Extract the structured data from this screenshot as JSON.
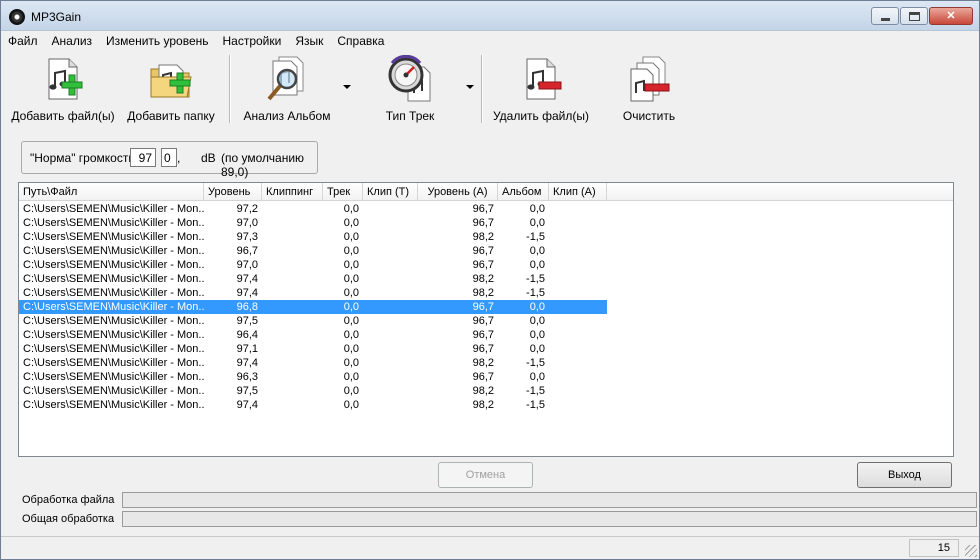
{
  "window": {
    "title": "MP3Gain"
  },
  "menu": [
    "Файл",
    "Анализ",
    "Изменить уровень",
    "Настройки",
    "Язык",
    "Справка"
  ],
  "toolbar": {
    "add_file": "Добавить файл(ы)",
    "add_folder": "Добавить папку",
    "analysis": "Анализ Альбом",
    "track_type": "Тип Трек",
    "remove_file": "Удалить файл(ы)",
    "clear": "Очистить"
  },
  "norm": {
    "label": "\"Норма\" громкости:",
    "int_value": "97",
    "comma": ",",
    "frac_value": "0",
    "unit": "dB",
    "default_text": "(по умолчанию 89,0)"
  },
  "table": {
    "columns": [
      "Путь\\Файл",
      "Уровень",
      "Клиппинг",
      "Трек",
      "Клип (Т)",
      "Уровень (A)",
      "Альбом",
      "Клип (A)"
    ],
    "rows": [
      {
        "path": "C:\\Users\\SEMEN\\Music\\Killer - Mon...",
        "level": "97,2",
        "clipping": "",
        "track": "0,0",
        "clip_t": "",
        "level_a": "96,7",
        "album": "0,0",
        "clip_a": ""
      },
      {
        "path": "C:\\Users\\SEMEN\\Music\\Killer - Mon...",
        "level": "97,0",
        "clipping": "",
        "track": "0,0",
        "clip_t": "",
        "level_a": "96,7",
        "album": "0,0",
        "clip_a": ""
      },
      {
        "path": "C:\\Users\\SEMEN\\Music\\Killer - Mon...",
        "level": "97,3",
        "clipping": "",
        "track": "0,0",
        "clip_t": "",
        "level_a": "98,2",
        "album": "-1,5",
        "clip_a": ""
      },
      {
        "path": "C:\\Users\\SEMEN\\Music\\Killer - Mon...",
        "level": "96,7",
        "clipping": "",
        "track": "0,0",
        "clip_t": "",
        "level_a": "96,7",
        "album": "0,0",
        "clip_a": ""
      },
      {
        "path": "C:\\Users\\SEMEN\\Music\\Killer - Mon...",
        "level": "97,0",
        "clipping": "",
        "track": "0,0",
        "clip_t": "",
        "level_a": "96,7",
        "album": "0,0",
        "clip_a": ""
      },
      {
        "path": "C:\\Users\\SEMEN\\Music\\Killer - Mon...",
        "level": "97,4",
        "clipping": "",
        "track": "0,0",
        "clip_t": "",
        "level_a": "98,2",
        "album": "-1,5",
        "clip_a": ""
      },
      {
        "path": "C:\\Users\\SEMEN\\Music\\Killer - Mon...",
        "level": "97,4",
        "clipping": "",
        "track": "0,0",
        "clip_t": "",
        "level_a": "98,2",
        "album": "-1,5",
        "clip_a": ""
      },
      {
        "path": "C:\\Users\\SEMEN\\Music\\Killer - Mon...",
        "level": "96,8",
        "clipping": "",
        "track": "0,0",
        "clip_t": "",
        "level_a": "96,7",
        "album": "0,0",
        "clip_a": "",
        "selected": true
      },
      {
        "path": "C:\\Users\\SEMEN\\Music\\Killer - Mon...",
        "level": "97,5",
        "clipping": "",
        "track": "0,0",
        "clip_t": "",
        "level_a": "96,7",
        "album": "0,0",
        "clip_a": ""
      },
      {
        "path": "C:\\Users\\SEMEN\\Music\\Killer - Mon...",
        "level": "96,4",
        "clipping": "",
        "track": "0,0",
        "clip_t": "",
        "level_a": "96,7",
        "album": "0,0",
        "clip_a": ""
      },
      {
        "path": "C:\\Users\\SEMEN\\Music\\Killer - Mon...",
        "level": "97,1",
        "clipping": "",
        "track": "0,0",
        "clip_t": "",
        "level_a": "96,7",
        "album": "0,0",
        "clip_a": ""
      },
      {
        "path": "C:\\Users\\SEMEN\\Music\\Killer - Mon...",
        "level": "97,4",
        "clipping": "",
        "track": "0,0",
        "clip_t": "",
        "level_a": "98,2",
        "album": "-1,5",
        "clip_a": ""
      },
      {
        "path": "C:\\Users\\SEMEN\\Music\\Killer - Mon...",
        "level": "96,3",
        "clipping": "",
        "track": "0,0",
        "clip_t": "",
        "level_a": "96,7",
        "album": "0,0",
        "clip_a": ""
      },
      {
        "path": "C:\\Users\\SEMEN\\Music\\Killer - Mon...",
        "level": "97,5",
        "clipping": "",
        "track": "0,0",
        "clip_t": "",
        "level_a": "98,2",
        "album": "-1,5",
        "clip_a": ""
      },
      {
        "path": "C:\\Users\\SEMEN\\Music\\Killer - Mon...",
        "level": "97,4",
        "clipping": "",
        "track": "0,0",
        "clip_t": "",
        "level_a": "98,2",
        "album": "-1,5",
        "clip_a": ""
      }
    ]
  },
  "buttons": {
    "cancel": "Отмена",
    "exit": "Выход"
  },
  "progress": {
    "file_label": "Обработка файла",
    "file_fraction": 0,
    "total_label": "Общая обработка",
    "total_fraction": 0
  },
  "status": {
    "count": "15"
  },
  "colors": {
    "selection": "#3399ff",
    "add_icon": "#2fbf3a",
    "remove_icon": "#d6242c"
  }
}
